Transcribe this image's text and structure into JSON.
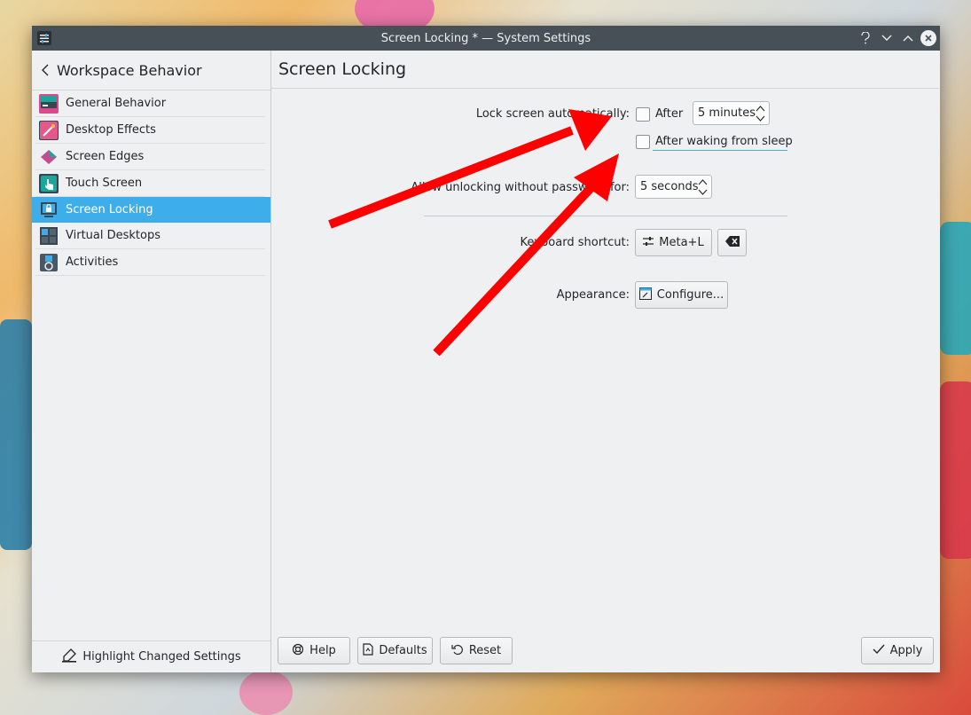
{
  "window": {
    "title": "Screen Locking * — System Settings"
  },
  "sidebar": {
    "header": "Workspace Behavior",
    "items": [
      {
        "label": "General Behavior",
        "icon": "general-behavior-icon",
        "color": "#d94b8a"
      },
      {
        "label": "Desktop Effects",
        "icon": "desktop-effects-icon",
        "color": "#2f7fbf"
      },
      {
        "label": "Screen Edges",
        "icon": "screen-edges-icon",
        "color": "#c94b8f"
      },
      {
        "label": "Touch Screen",
        "icon": "touch-screen-icon",
        "color": "#1da59b"
      },
      {
        "label": "Screen Locking",
        "icon": "screen-locking-icon",
        "color": "#3a4552",
        "active": true
      },
      {
        "label": "Virtual Desktops",
        "icon": "virtual-desktops-icon",
        "color": "#3a4552"
      },
      {
        "label": "Activities",
        "icon": "activities-icon",
        "color": "#4a5866"
      }
    ],
    "footer": "Highlight Changed Settings"
  },
  "main": {
    "title": "Screen Locking",
    "lock_label": "Lock screen automatically:",
    "after_label": "After",
    "after_value": "5 minutes",
    "after_sleep_label": "After waking from sleep",
    "unlock_label": "Allow unlocking without password for:",
    "unlock_value": "5 seconds",
    "shortcut_label": "Keyboard shortcut:",
    "shortcut_value": "Meta+L",
    "appearance_label": "Appearance:",
    "configure_label": "Configure..."
  },
  "bottombar": {
    "help": "Help",
    "defaults": "Defaults",
    "reset": "Reset",
    "apply": "Apply"
  },
  "colors": {
    "accent": "#3daee9",
    "titlebar": "#475057",
    "annotation_arrow": "#ff0000"
  }
}
